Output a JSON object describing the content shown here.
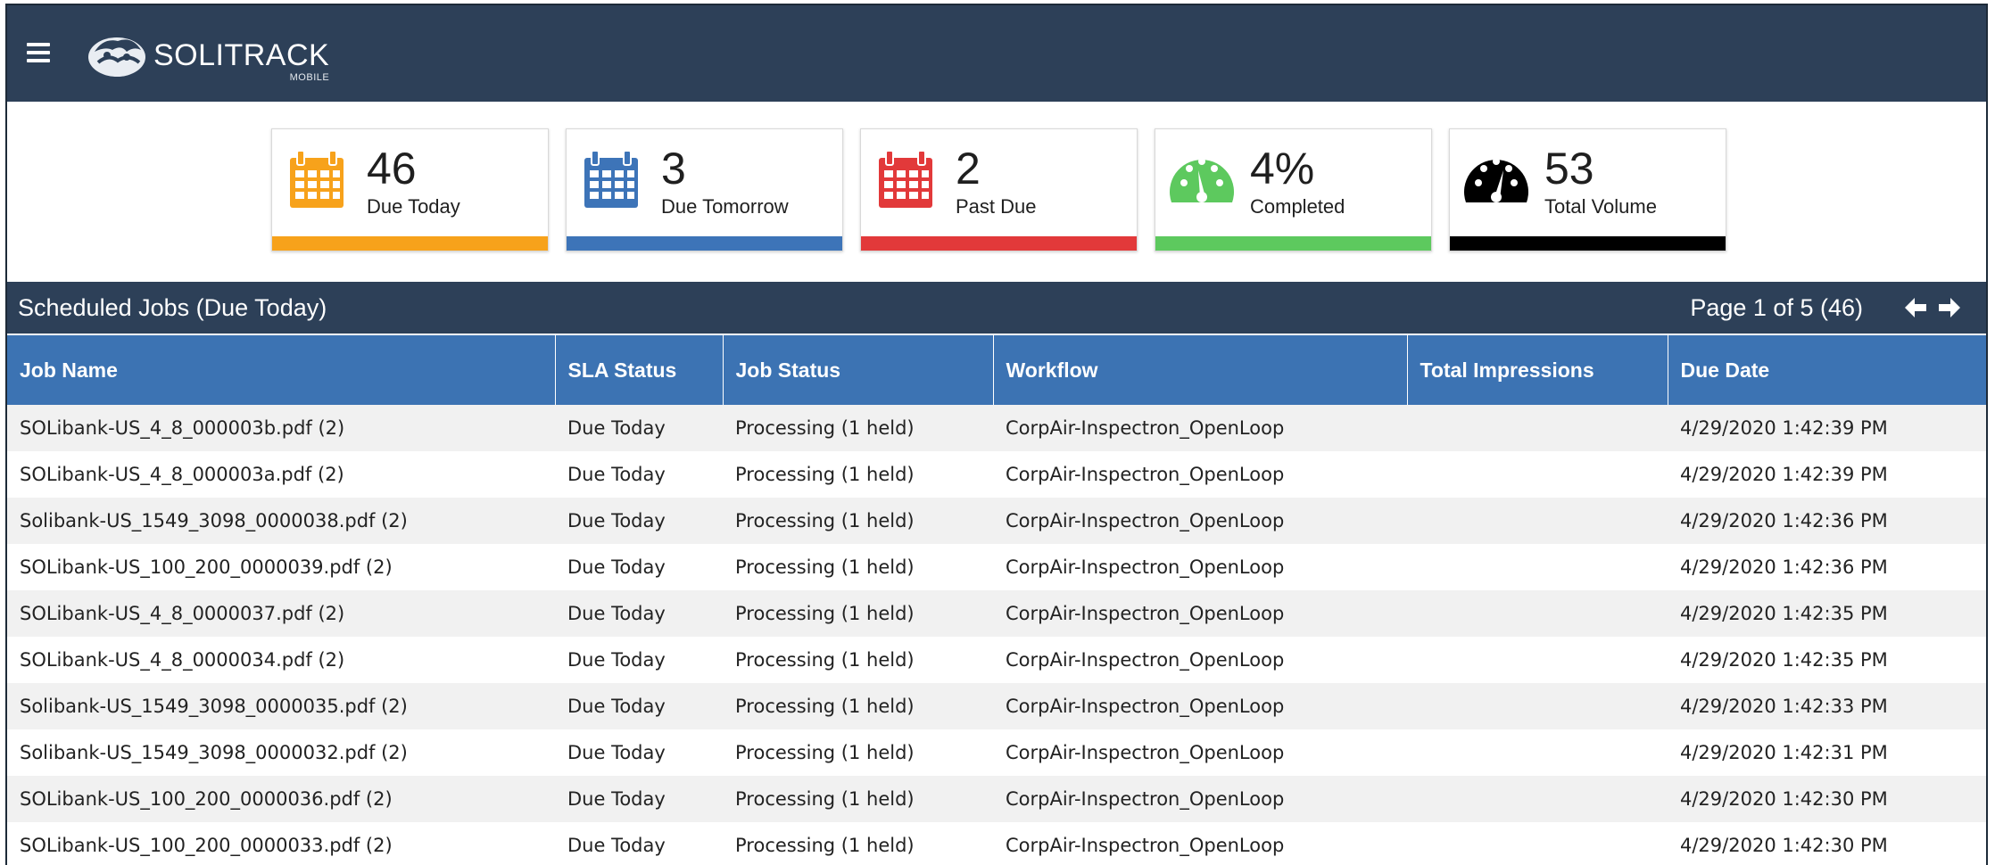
{
  "app": {
    "name": "SOLITRACK",
    "sub": "MOBILE"
  },
  "colors": {
    "header_bg": "#2d4058",
    "table_header_bg": "#3c73b3",
    "orange": "#f7a21b",
    "blue": "#3d74b8",
    "red": "#e2393a",
    "green": "#5dc95e",
    "black": "#000000"
  },
  "cards": [
    {
      "value": "46",
      "label": "Due Today",
      "icon": "calendar-icon",
      "color": "#f7a21b"
    },
    {
      "value": "3",
      "label": "Due Tomorrow",
      "icon": "calendar-icon",
      "color": "#3d74b8"
    },
    {
      "value": "2",
      "label": "Past Due",
      "icon": "calendar-icon",
      "color": "#e2393a"
    },
    {
      "value": "4%",
      "label": "Completed",
      "icon": "gauge-icon",
      "color": "#5dc95e"
    },
    {
      "value": "53",
      "label": "Total Volume",
      "icon": "gauge-icon",
      "color": "#000000"
    }
  ],
  "jobs_panel": {
    "title": "Scheduled Jobs (Due Today)",
    "pager": "Page 1 of 5 (46)",
    "prev_icon": "arrow-left-icon",
    "next_icon": "arrow-right-icon"
  },
  "table": {
    "columns": [
      "Job Name",
      "SLA Status",
      "Job Status",
      "Workflow",
      "Total Impressions",
      "Due Date"
    ],
    "rows": [
      [
        "SOLibank-US_4_8_000003b.pdf (2)",
        "Due Today",
        "Processing (1 held)",
        "CorpAir-Inspectron_OpenLoop",
        "",
        "4/29/2020 1:42:39 PM"
      ],
      [
        "SOLibank-US_4_8_000003a.pdf (2)",
        "Due Today",
        "Processing (1 held)",
        "CorpAir-Inspectron_OpenLoop",
        "",
        "4/29/2020 1:42:39 PM"
      ],
      [
        "Solibank-US_1549_3098_0000038.pdf (2)",
        "Due Today",
        "Processing (1 held)",
        "CorpAir-Inspectron_OpenLoop",
        "",
        "4/29/2020 1:42:36 PM"
      ],
      [
        "SOLibank-US_100_200_0000039.pdf (2)",
        "Due Today",
        "Processing (1 held)",
        "CorpAir-Inspectron_OpenLoop",
        "",
        "4/29/2020 1:42:36 PM"
      ],
      [
        "SOLibank-US_4_8_0000037.pdf (2)",
        "Due Today",
        "Processing (1 held)",
        "CorpAir-Inspectron_OpenLoop",
        "",
        "4/29/2020 1:42:35 PM"
      ],
      [
        "SOLibank-US_4_8_0000034.pdf (2)",
        "Due Today",
        "Processing (1 held)",
        "CorpAir-Inspectron_OpenLoop",
        "",
        "4/29/2020 1:42:35 PM"
      ],
      [
        "Solibank-US_1549_3098_0000035.pdf (2)",
        "Due Today",
        "Processing (1 held)",
        "CorpAir-Inspectron_OpenLoop",
        "",
        "4/29/2020 1:42:33 PM"
      ],
      [
        "Solibank-US_1549_3098_0000032.pdf (2)",
        "Due Today",
        "Processing (1 held)",
        "CorpAir-Inspectron_OpenLoop",
        "",
        "4/29/2020 1:42:31 PM"
      ],
      [
        "SOLibank-US_100_200_0000036.pdf (2)",
        "Due Today",
        "Processing (1 held)",
        "CorpAir-Inspectron_OpenLoop",
        "",
        "4/29/2020 1:42:30 PM"
      ],
      [
        "SOLibank-US_100_200_0000033.pdf (2)",
        "Due Today",
        "Processing (1 held)",
        "CorpAir-Inspectron_OpenLoop",
        "",
        "4/29/2020 1:42:30 PM"
      ]
    ]
  }
}
